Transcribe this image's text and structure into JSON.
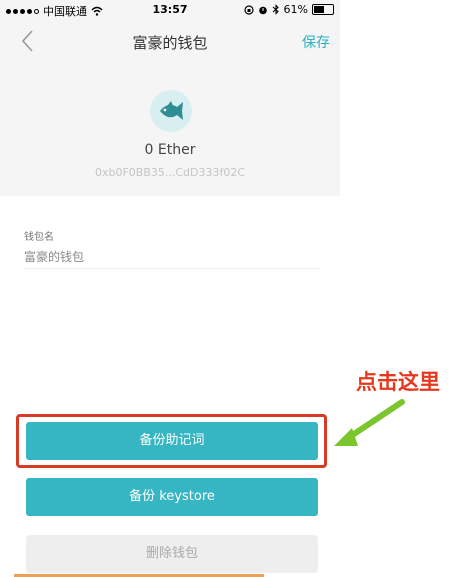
{
  "status_bar": {
    "carrier": "中国联通",
    "time": "13:57",
    "battery": "61%",
    "battery_level": 0.61
  },
  "nav": {
    "title": "富豪的钱包",
    "save_label": "保存"
  },
  "wallet": {
    "balance": "0 Ether",
    "address": "0xb0F0BB35...CdD333f02C"
  },
  "form": {
    "name_label": "钱包名",
    "name_value": "富豪的钱包"
  },
  "annotation": {
    "text": "点击这里"
  },
  "buttons": {
    "backup_mnemonic": "备份助记词",
    "backup_keystore": "备份 keystore",
    "delete_wallet": "删除钱包"
  },
  "colors": {
    "accent": "#36b6c2",
    "save": "#2bb0c0",
    "highlight": "#d63b25",
    "arrow": "#7bc62d"
  }
}
